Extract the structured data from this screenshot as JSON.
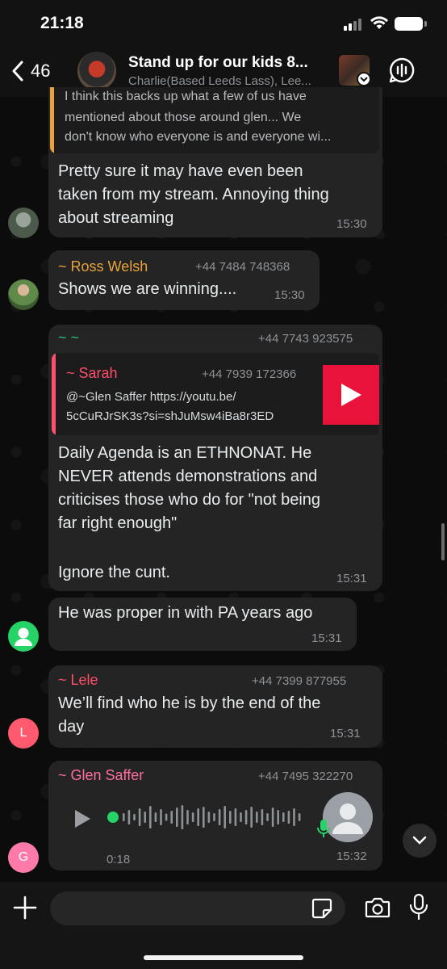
{
  "status_bar": {
    "time": "21:18"
  },
  "header": {
    "back_count": "46",
    "title": "Stand up for our kids 8...",
    "subtitle": "Charlie(Based Leeds Lass), Lee..."
  },
  "messages": [
    {
      "quote_lines": [
        "I think this backs up what a few of us have",
        "mentioned about those around glen... We",
        "don't know who everyone is and everyone wi..."
      ],
      "text_lines": [
        "Pretty sure it may have even been",
        "taken from my stream. Annoying thing",
        "about streaming"
      ],
      "time": "15:30"
    },
    {
      "sender": "~ Ross Welsh",
      "phone": "+44 7484 748368",
      "text_lines": [
        "Shows we are winning...."
      ],
      "time": "15:30"
    },
    {
      "sender": "~ ~",
      "phone": "+44 7743 923575",
      "quote_sender": "~ Sarah",
      "quote_phone": "+44 7939 172366",
      "quote_lines": [
        "@~Glen Saffer https://youtu.be/",
        "5cCuRJrSK3s?si=shJuMsw4iBa8r3ED"
      ],
      "text_lines": [
        "Daily Agenda is an ETHNONAT. He",
        "NEVER attends demonstrations and",
        "criticises those who do for \"not being",
        "far right enough\"",
        "",
        "Ignore the cunt."
      ],
      "time": "15:31"
    },
    {
      "text_lines": [
        "He was proper in with PA years ago"
      ],
      "time": "15:31"
    },
    {
      "sender": "~ Lele",
      "phone": "+44 7399 877955",
      "avatar_letter": "L",
      "text_lines": [
        "We’ll find who he is by the end of the",
        "day"
      ],
      "time": "15:31"
    },
    {
      "sender": "~ Glen Saffer",
      "phone": "+44 7495 322270",
      "avatar_letter": "G",
      "voice_duration": "0:18",
      "time": "15:32"
    }
  ],
  "colors": {
    "accent_green": "#25d366",
    "sender_ross": "#e9a23b",
    "sender_tilde": "#27c281",
    "sender_sarah": "#ff4f6a",
    "sender_lele": "#ff4f6a",
    "sender_glen": "#ff6ea0",
    "quote_bar_1": "#e9a23b",
    "quote_bar_2": "#ff4f6a"
  },
  "input": {
    "placeholder": ""
  },
  "icons": {
    "back": "chevron-left-icon",
    "call": "voice-call-icon",
    "plus": "plus-icon",
    "sticker": "sticker-icon",
    "camera": "camera-icon",
    "mic": "mic-icon",
    "play": "play-icon",
    "scroll_down": "chevron-down-icon"
  }
}
